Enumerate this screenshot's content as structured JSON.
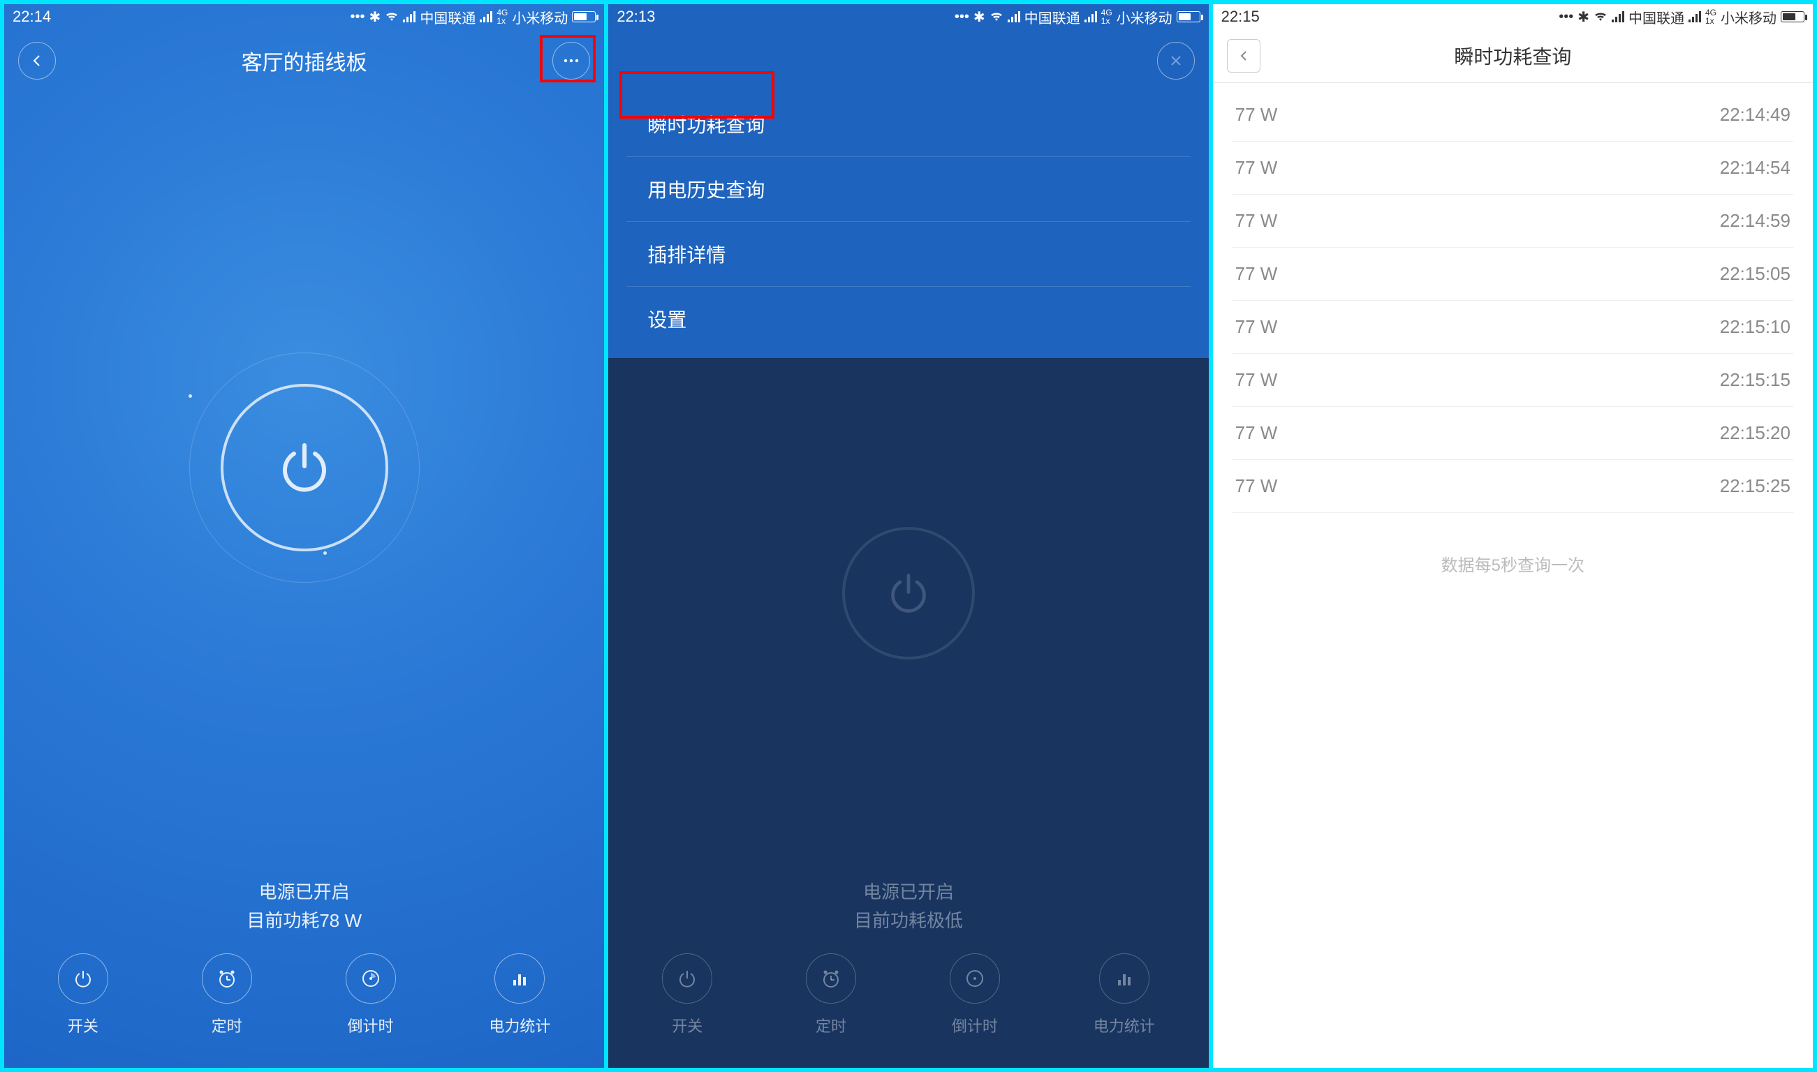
{
  "screen1": {
    "statusbar": {
      "time": "22:14",
      "carrier1": "中国联通",
      "carrier2": "小米移动"
    },
    "header": {
      "title": "客厅的插线板"
    },
    "status_line1": "电源已开启",
    "status_line2": "目前功耗78 W",
    "nav": [
      {
        "label": "开关",
        "icon": "power-icon"
      },
      {
        "label": "定时",
        "icon": "clock-icon"
      },
      {
        "label": "倒计时",
        "icon": "countdown-icon"
      },
      {
        "label": "电力统计",
        "icon": "barchart-icon"
      }
    ]
  },
  "screen2": {
    "statusbar": {
      "time": "22:13",
      "carrier1": "中国联通",
      "carrier2": "小米移动"
    },
    "menu": [
      "瞬时功耗查询",
      "用电历史查询",
      "插排详情",
      "设置"
    ],
    "status_line1": "电源已开启",
    "status_line2": "目前功耗极低",
    "nav": [
      {
        "label": "开关"
      },
      {
        "label": "定时"
      },
      {
        "label": "倒计时"
      },
      {
        "label": "电力统计"
      }
    ]
  },
  "screen3": {
    "statusbar": {
      "time": "22:15",
      "carrier1": "中国联通",
      "carrier2": "小米移动"
    },
    "header": {
      "title": "瞬时功耗查询"
    },
    "rows": [
      {
        "v": "77 W",
        "t": "22:14:49"
      },
      {
        "v": "77 W",
        "t": "22:14:54"
      },
      {
        "v": "77 W",
        "t": "22:14:59"
      },
      {
        "v": "77 W",
        "t": "22:15:05"
      },
      {
        "v": "77 W",
        "t": "22:15:10"
      },
      {
        "v": "77 W",
        "t": "22:15:15"
      },
      {
        "v": "77 W",
        "t": "22:15:20"
      },
      {
        "v": "77 W",
        "t": "22:15:25"
      }
    ],
    "footnote": "数据每5秒查询一次"
  }
}
